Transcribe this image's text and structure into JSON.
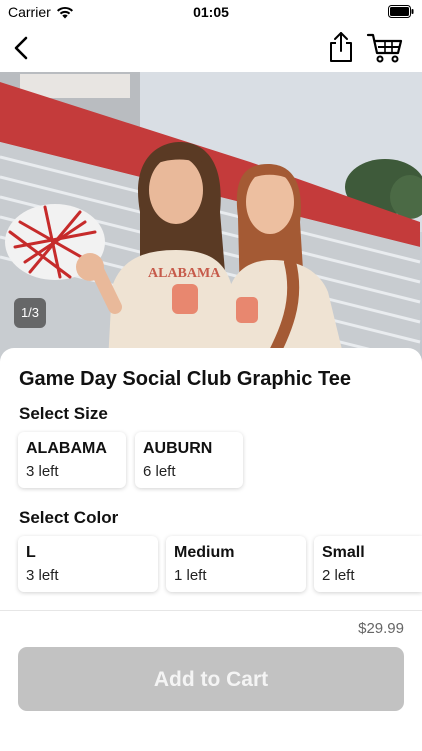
{
  "status_bar": {
    "carrier": "Carrier",
    "time": "01:05"
  },
  "nav": {
    "back_icon": "chevron-left-icon",
    "share_icon": "share-icon",
    "cart_icon": "cart-icon"
  },
  "gallery": {
    "counter": "1/3",
    "image_description_icon": "product-photo"
  },
  "product": {
    "title": "Game Day Social Club Graphic Tee",
    "size_heading": "Select Size",
    "sizes": [
      {
        "name": "ALABAMA",
        "stock": "3 left"
      },
      {
        "name": "AUBURN",
        "stock": "6 left"
      }
    ],
    "color_heading": "Select Color",
    "colors": [
      {
        "name": "L",
        "stock": "3 left"
      },
      {
        "name": "Medium",
        "stock": "1 left"
      },
      {
        "name": "Small",
        "stock": "2 left"
      }
    ]
  },
  "footer": {
    "price": "$29.99",
    "add_to_cart": "Add to Cart"
  },
  "colors": {
    "button_disabled": "#c2c2c2",
    "text": "#111111",
    "price": "#666666"
  }
}
